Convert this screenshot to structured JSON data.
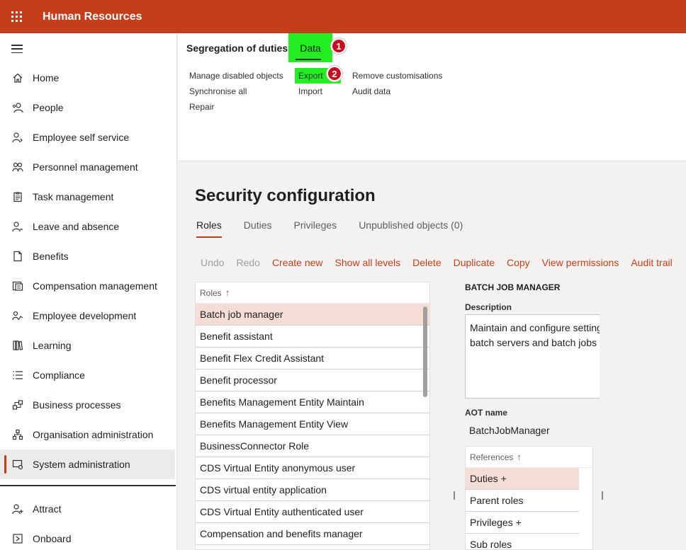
{
  "app": {
    "title": "Human Resources"
  },
  "sidebar": {
    "items": [
      {
        "label": "Home"
      },
      {
        "label": "People"
      },
      {
        "label": "Employee self service"
      },
      {
        "label": "Personnel management"
      },
      {
        "label": "Task management"
      },
      {
        "label": "Leave and absence"
      },
      {
        "label": "Benefits"
      },
      {
        "label": "Compensation management"
      },
      {
        "label": "Employee development"
      },
      {
        "label": "Learning"
      },
      {
        "label": "Compliance"
      },
      {
        "label": "Business processes"
      },
      {
        "label": "Organisation administration"
      },
      {
        "label": "System administration"
      }
    ],
    "items2": [
      {
        "label": "Attract"
      },
      {
        "label": "Onboard"
      }
    ]
  },
  "actionpane": {
    "tab_sod": "Segregation of duties",
    "tab_data": "Data",
    "badge1": "1",
    "badge2": "2",
    "group1": [
      "Manage disabled objects",
      "Synchronise all",
      "Repair"
    ],
    "group2": [
      "Export",
      "Import"
    ],
    "group3": [
      "Remove customisations",
      "Audit data"
    ]
  },
  "main": {
    "title": "Security configuration",
    "tabs": [
      "Roles",
      "Duties",
      "Privileges",
      "Unpublished objects (0)"
    ],
    "toolbar": [
      "Undo",
      "Redo",
      "Create new",
      "Show all levels",
      "Delete",
      "Duplicate",
      "Copy",
      "View permissions",
      "Audit trail"
    ]
  },
  "roles": {
    "header": "Roles",
    "sort_arrow": "↑",
    "rows": [
      "Batch job manager",
      "Benefit assistant",
      "Benefit Flex Credit Assistant",
      "Benefit processor",
      "Benefits Management Entity Maintain",
      "Benefits Management Entity View",
      "BusinessConnector Role",
      "CDS Virtual Entity anonymous user",
      "CDS virtual entity application",
      "CDS Virtual Entity authenticated user",
      "Compensation and benefits manager"
    ]
  },
  "details": {
    "title": "BATCH JOB MANAGER",
    "description_label": "Description",
    "description_line1": "Maintain and configure settings for",
    "description_line2": "batch servers and batch jobs",
    "aot_label": "AOT name",
    "aot_value": "BatchJobManager"
  },
  "references": {
    "header": "References",
    "sort_arrow": "↑",
    "rows": [
      "Duties +",
      "Parent roles",
      "Privileges +",
      "Sub roles"
    ]
  },
  "colors": {
    "brand": "#c43e1c",
    "highlight": "#22ee22",
    "selected_row": "#f4dcd7",
    "badge": "#c50f1f"
  }
}
